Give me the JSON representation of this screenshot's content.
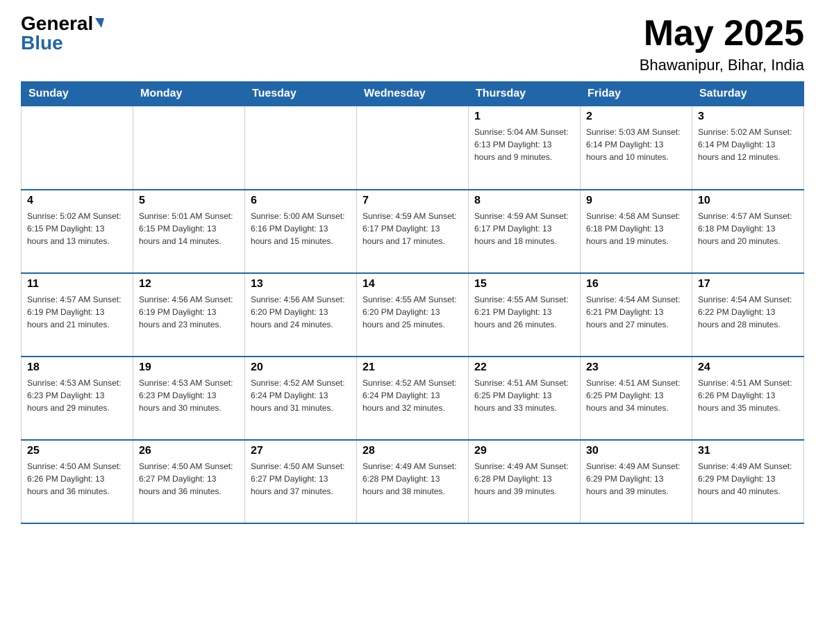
{
  "header": {
    "logo": {
      "general": "General",
      "blue": "Blue",
      "aria": "GeneralBlue logo"
    },
    "title": "May 2025",
    "location": "Bhawanipur, Bihar, India"
  },
  "days_of_week": [
    "Sunday",
    "Monday",
    "Tuesday",
    "Wednesday",
    "Thursday",
    "Friday",
    "Saturday"
  ],
  "weeks": [
    [
      {
        "day": "",
        "info": ""
      },
      {
        "day": "",
        "info": ""
      },
      {
        "day": "",
        "info": ""
      },
      {
        "day": "",
        "info": ""
      },
      {
        "day": "1",
        "info": "Sunrise: 5:04 AM\nSunset: 6:13 PM\nDaylight: 13 hours and 9 minutes."
      },
      {
        "day": "2",
        "info": "Sunrise: 5:03 AM\nSunset: 6:14 PM\nDaylight: 13 hours and 10 minutes."
      },
      {
        "day": "3",
        "info": "Sunrise: 5:02 AM\nSunset: 6:14 PM\nDaylight: 13 hours and 12 minutes."
      }
    ],
    [
      {
        "day": "4",
        "info": "Sunrise: 5:02 AM\nSunset: 6:15 PM\nDaylight: 13 hours and 13 minutes."
      },
      {
        "day": "5",
        "info": "Sunrise: 5:01 AM\nSunset: 6:15 PM\nDaylight: 13 hours and 14 minutes."
      },
      {
        "day": "6",
        "info": "Sunrise: 5:00 AM\nSunset: 6:16 PM\nDaylight: 13 hours and 15 minutes."
      },
      {
        "day": "7",
        "info": "Sunrise: 4:59 AM\nSunset: 6:17 PM\nDaylight: 13 hours and 17 minutes."
      },
      {
        "day": "8",
        "info": "Sunrise: 4:59 AM\nSunset: 6:17 PM\nDaylight: 13 hours and 18 minutes."
      },
      {
        "day": "9",
        "info": "Sunrise: 4:58 AM\nSunset: 6:18 PM\nDaylight: 13 hours and 19 minutes."
      },
      {
        "day": "10",
        "info": "Sunrise: 4:57 AM\nSunset: 6:18 PM\nDaylight: 13 hours and 20 minutes."
      }
    ],
    [
      {
        "day": "11",
        "info": "Sunrise: 4:57 AM\nSunset: 6:19 PM\nDaylight: 13 hours and 21 minutes."
      },
      {
        "day": "12",
        "info": "Sunrise: 4:56 AM\nSunset: 6:19 PM\nDaylight: 13 hours and 23 minutes."
      },
      {
        "day": "13",
        "info": "Sunrise: 4:56 AM\nSunset: 6:20 PM\nDaylight: 13 hours and 24 minutes."
      },
      {
        "day": "14",
        "info": "Sunrise: 4:55 AM\nSunset: 6:20 PM\nDaylight: 13 hours and 25 minutes."
      },
      {
        "day": "15",
        "info": "Sunrise: 4:55 AM\nSunset: 6:21 PM\nDaylight: 13 hours and 26 minutes."
      },
      {
        "day": "16",
        "info": "Sunrise: 4:54 AM\nSunset: 6:21 PM\nDaylight: 13 hours and 27 minutes."
      },
      {
        "day": "17",
        "info": "Sunrise: 4:54 AM\nSunset: 6:22 PM\nDaylight: 13 hours and 28 minutes."
      }
    ],
    [
      {
        "day": "18",
        "info": "Sunrise: 4:53 AM\nSunset: 6:23 PM\nDaylight: 13 hours and 29 minutes."
      },
      {
        "day": "19",
        "info": "Sunrise: 4:53 AM\nSunset: 6:23 PM\nDaylight: 13 hours and 30 minutes."
      },
      {
        "day": "20",
        "info": "Sunrise: 4:52 AM\nSunset: 6:24 PM\nDaylight: 13 hours and 31 minutes."
      },
      {
        "day": "21",
        "info": "Sunrise: 4:52 AM\nSunset: 6:24 PM\nDaylight: 13 hours and 32 minutes."
      },
      {
        "day": "22",
        "info": "Sunrise: 4:51 AM\nSunset: 6:25 PM\nDaylight: 13 hours and 33 minutes."
      },
      {
        "day": "23",
        "info": "Sunrise: 4:51 AM\nSunset: 6:25 PM\nDaylight: 13 hours and 34 minutes."
      },
      {
        "day": "24",
        "info": "Sunrise: 4:51 AM\nSunset: 6:26 PM\nDaylight: 13 hours and 35 minutes."
      }
    ],
    [
      {
        "day": "25",
        "info": "Sunrise: 4:50 AM\nSunset: 6:26 PM\nDaylight: 13 hours and 36 minutes."
      },
      {
        "day": "26",
        "info": "Sunrise: 4:50 AM\nSunset: 6:27 PM\nDaylight: 13 hours and 36 minutes."
      },
      {
        "day": "27",
        "info": "Sunrise: 4:50 AM\nSunset: 6:27 PM\nDaylight: 13 hours and 37 minutes."
      },
      {
        "day": "28",
        "info": "Sunrise: 4:49 AM\nSunset: 6:28 PM\nDaylight: 13 hours and 38 minutes."
      },
      {
        "day": "29",
        "info": "Sunrise: 4:49 AM\nSunset: 6:28 PM\nDaylight: 13 hours and 39 minutes."
      },
      {
        "day": "30",
        "info": "Sunrise: 4:49 AM\nSunset: 6:29 PM\nDaylight: 13 hours and 39 minutes."
      },
      {
        "day": "31",
        "info": "Sunrise: 4:49 AM\nSunset: 6:29 PM\nDaylight: 13 hours and 40 minutes."
      }
    ]
  ]
}
